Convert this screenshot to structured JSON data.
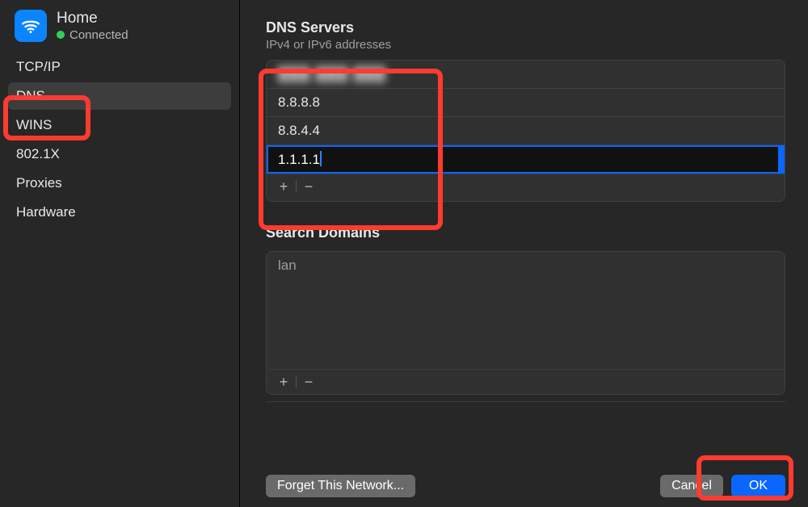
{
  "network": {
    "name": "Home",
    "status_label": "Connected"
  },
  "sidebar": {
    "items": [
      {
        "label": "TCP/IP",
        "selected": false
      },
      {
        "label": "DNS",
        "selected": true
      },
      {
        "label": "WINS",
        "selected": false
      },
      {
        "label": "802.1X",
        "selected": false
      },
      {
        "label": "Proxies",
        "selected": false
      },
      {
        "label": "Hardware",
        "selected": false
      }
    ]
  },
  "dns": {
    "title": "DNS Servers",
    "subtitle": "IPv4 or IPv6 addresses",
    "servers": [
      {
        "value": "███ ███ ███",
        "redacted": true
      },
      {
        "value": "8.8.8.8"
      },
      {
        "value": "8.8.4.4"
      },
      {
        "value": "1.1.1.1",
        "editing": true
      }
    ],
    "add_glyph": "+",
    "remove_glyph": "−"
  },
  "domains": {
    "title": "Search Domains",
    "items": [
      {
        "value": "lan"
      }
    ],
    "add_glyph": "+",
    "remove_glyph": "−"
  },
  "footer": {
    "forget": "Forget This Network...",
    "cancel": "Cancel",
    "ok": "OK"
  }
}
